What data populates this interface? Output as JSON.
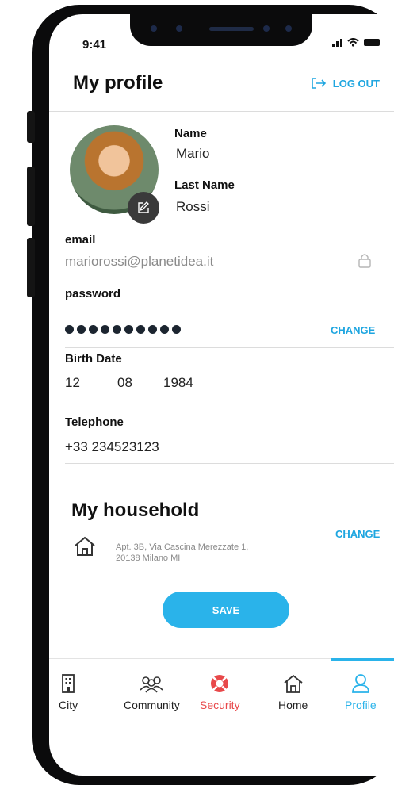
{
  "status_bar": {
    "time": "9:41"
  },
  "header": {
    "title": "My profile",
    "logout_label": "LOG OUT"
  },
  "profile": {
    "name_label": "Name",
    "name_value": "Mario",
    "lastname_label": "Last Name",
    "lastname_value": "Rossi"
  },
  "fields": {
    "email_label": "email",
    "email_value": "mariorossi@planetidea.it",
    "password_label": "password",
    "password_change": "CHANGE",
    "birth_label": "Birth Date",
    "birth_day": "12",
    "birth_month": "08",
    "birth_year": "1984",
    "phone_label": "Telephone",
    "phone_value": "+33 234523123"
  },
  "household": {
    "title": "My household",
    "address_line1": "Apt. 3B, Via Cascina Merezzate 1,",
    "address_line2": "20138 Milano MI",
    "change_label": "CHANGE"
  },
  "save_label": "SAVE",
  "tabs": [
    {
      "label": "City",
      "icon": "building-icon"
    },
    {
      "label": "Community",
      "icon": "people-icon"
    },
    {
      "label": "Security",
      "icon": "lifebuoy-icon"
    },
    {
      "label": "Home",
      "icon": "house-icon"
    },
    {
      "label": "Profile",
      "icon": "person-icon"
    }
  ],
  "colors": {
    "accent": "#2ab3ea",
    "security": "#e8484a",
    "text": "#111111"
  }
}
